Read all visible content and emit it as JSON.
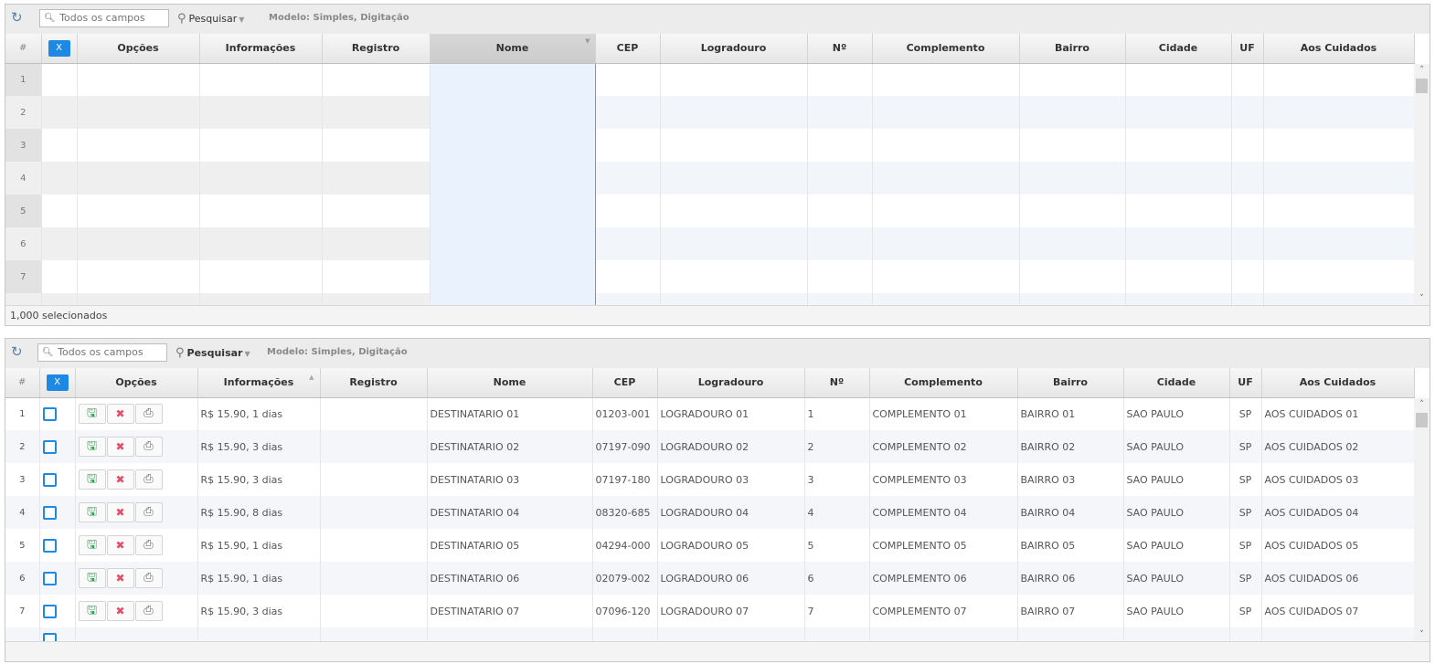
{
  "grid1": {
    "search_placeholder": "Todos os campos",
    "pesquisar_label": "Pesquisar",
    "modelo_label": "Modelo: Simples, Digitação",
    "columns": [
      "#",
      "X",
      "Opções",
      "Informações",
      "Registro",
      "Nome",
      "CEP",
      "Logradouro",
      "Nº",
      "Complemento",
      "Bairro",
      "Cidade",
      "UF",
      "Aos Cuidados"
    ],
    "row_numbers": [
      "1",
      "2",
      "3",
      "4",
      "5",
      "6",
      "7"
    ],
    "status_text": "1,000 selecionados"
  },
  "grid2": {
    "search_placeholder": "Todos os campos",
    "pesquisar_label": "Pesquisar",
    "modelo_label": "Modelo: Simples, Digitação",
    "columns": [
      "#",
      "X",
      "Opções",
      "Informações",
      "Registro",
      "Nome",
      "CEP",
      "Logradouro",
      "Nº",
      "Complemento",
      "Bairro",
      "Cidade",
      "UF",
      "Aos Cuidados"
    ],
    "rows": [
      {
        "num": "1",
        "info": "R$ 15.90, 1 dias",
        "nome": "DESTINATARIO 01",
        "cep": "01203-001",
        "logradouro": "LOGRADOURO 01",
        "numero": "1",
        "complemento": "COMPLEMENTO 01",
        "bairro": "BAIRRO 01",
        "cidade": "SAO PAULO",
        "uf": "SP",
        "aos_cuidados": "AOS CUIDADOS 01"
      },
      {
        "num": "2",
        "info": "R$ 15.90, 3 dias",
        "nome": "DESTINATARIO 02",
        "cep": "07197-090",
        "logradouro": "LOGRADOURO 02",
        "numero": "2",
        "complemento": "COMPLEMENTO 02",
        "bairro": "BAIRRO 02",
        "cidade": "SAO PAULO",
        "uf": "SP",
        "aos_cuidados": "AOS CUIDADOS 02"
      },
      {
        "num": "3",
        "info": "R$ 15.90, 3 dias",
        "nome": "DESTINATARIO 03",
        "cep": "07197-180",
        "logradouro": "LOGRADOURO 03",
        "numero": "3",
        "complemento": "COMPLEMENTO 03",
        "bairro": "BAIRRO 03",
        "cidade": "SAO PAULO",
        "uf": "SP",
        "aos_cuidados": "AOS CUIDADOS 03"
      },
      {
        "num": "4",
        "info": "R$ 15.90, 8 dias",
        "nome": "DESTINATARIO 04",
        "cep": "08320-685",
        "logradouro": "LOGRADOURO 04",
        "numero": "4",
        "complemento": "COMPLEMENTO 04",
        "bairro": "BAIRRO 04",
        "cidade": "SAO PAULO",
        "uf": "SP",
        "aos_cuidados": "AOS CUIDADOS 04"
      },
      {
        "num": "5",
        "info": "R$ 15.90, 1 dias",
        "nome": "DESTINATARIO 05",
        "cep": "04294-000",
        "logradouro": "LOGRADOURO 05",
        "numero": "5",
        "complemento": "COMPLEMENTO 05",
        "bairro": "BAIRRO 05",
        "cidade": "SAO PAULO",
        "uf": "SP",
        "aos_cuidados": "AOS CUIDADOS 05"
      },
      {
        "num": "6",
        "info": "R$ 15.90, 1 dias",
        "nome": "DESTINATARIO 06",
        "cep": "02079-002",
        "logradouro": "LOGRADOURO 06",
        "numero": "6",
        "complemento": "COMPLEMENTO 06",
        "bairro": "BAIRRO 06",
        "cidade": "SAO PAULO",
        "uf": "SP",
        "aos_cuidados": "AOS CUIDADOS 06"
      },
      {
        "num": "7",
        "info": "R$ 15.90, 3 dias",
        "nome": "DESTINATARIO 07",
        "cep": "07096-120",
        "logradouro": "LOGRADOURO 07",
        "numero": "7",
        "complemento": "COMPLEMENTO 07",
        "bairro": "BAIRRO 07",
        "cidade": "SAO PAULO",
        "uf": "SP",
        "aos_cuidados": "AOS CUIDADOS 07"
      }
    ]
  },
  "icons": {
    "refresh": "refresh-icon",
    "search": "search-icon",
    "save": "save-icon",
    "delete": "delete-icon",
    "print": "print-icon"
  },
  "colors": {
    "accent": "#1e88e5",
    "save": "#22a34a",
    "delete": "#e0506a",
    "link": "#1e88e5"
  }
}
